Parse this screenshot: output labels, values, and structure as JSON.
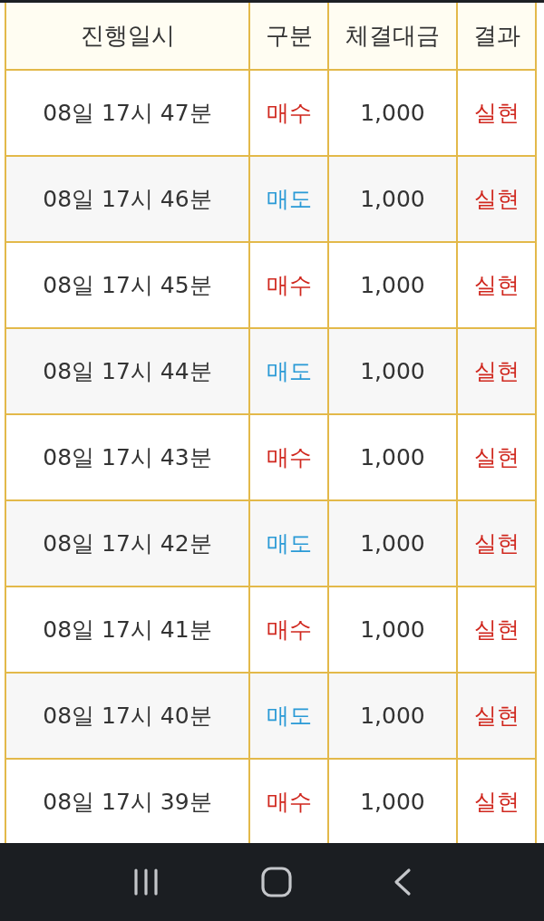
{
  "table": {
    "columns": [
      "진행일시",
      "구분",
      "체결대금",
      "결과"
    ],
    "rows": [
      {
        "time": "08일 17시 47분",
        "side": "매수",
        "color": "#d0281f",
        "amount": "1,000",
        "result": "실현"
      },
      {
        "time": "08일 17시 46분",
        "side": "매도",
        "color": "#2a9ad6",
        "amount": "1,000",
        "result": "실현"
      },
      {
        "time": "08일 17시 45분",
        "side": "매수",
        "color": "#d0281f",
        "amount": "1,000",
        "result": "실현"
      },
      {
        "time": "08일 17시 44분",
        "side": "매도",
        "color": "#2a9ad6",
        "amount": "1,000",
        "result": "실현"
      },
      {
        "time": "08일 17시 43분",
        "side": "매수",
        "color": "#d0281f",
        "amount": "1,000",
        "result": "실현"
      },
      {
        "time": "08일 17시 42분",
        "side": "매도",
        "color": "#2a9ad6",
        "amount": "1,000",
        "result": "실현"
      },
      {
        "time": "08일 17시 41분",
        "side": "매수",
        "color": "#d0281f",
        "amount": "1,000",
        "result": "실현"
      },
      {
        "time": "08일 17시 40분",
        "side": "매도",
        "color": "#2a9ad6",
        "amount": "1,000",
        "result": "실현"
      },
      {
        "time": "08일 17시 39분",
        "side": "매수",
        "color": "#d0281f",
        "amount": "1,000",
        "result": "실현"
      }
    ]
  }
}
